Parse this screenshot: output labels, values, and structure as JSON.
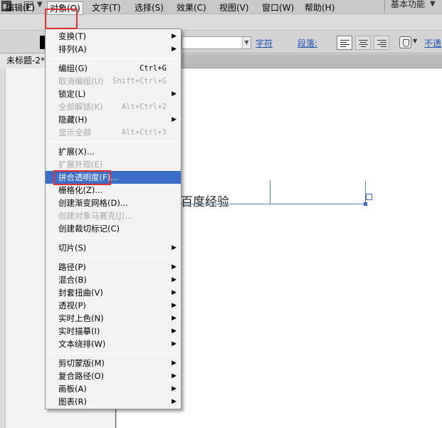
{
  "app_bar": {
    "logo": "Br",
    "workspace": "基本功能"
  },
  "menubar": {
    "edit": "编辑(E)",
    "object": "对象(O)",
    "text": "文字(T)",
    "select": "选择(S)",
    "effect": "效果(C)",
    "view": "视图(V)",
    "window": "窗口(W)",
    "help": "帮助(H)"
  },
  "control_bar": {
    "char_link": "字符",
    "para_link": "段落:",
    "opacity_link": "不透"
  },
  "doc_tab": {
    "title": "未标题-2*"
  },
  "canvas": {
    "text": "百度经验"
  },
  "object_menu": {
    "items": [
      {
        "label": "变换(T)",
        "submenu": true
      },
      {
        "label": "排列(A)",
        "submenu": true
      },
      {
        "label": "编组(G)",
        "shortcut": "Ctrl+G"
      },
      {
        "label": "取消编组(U)",
        "shortcut": "Shift+Ctrl+G",
        "disabled": true
      },
      {
        "label": "锁定(L)",
        "submenu": true
      },
      {
        "label": "全部解锁(K)",
        "shortcut": "Alt+Ctrl+2",
        "disabled": true
      },
      {
        "label": "隐藏(H)",
        "submenu": true
      },
      {
        "label": "显示全部",
        "shortcut": "Alt+Ctrl+3",
        "disabled": true
      },
      {
        "label": "扩展(X)..."
      },
      {
        "label": "扩展外观(E)",
        "disabled": true
      },
      {
        "label": "拼合透明度(F)...",
        "selected": true
      },
      {
        "label": "栅格化(Z)..."
      },
      {
        "label": "创建渐变网格(D)..."
      },
      {
        "label": "创建对象马赛克(J)...",
        "disabled": true
      },
      {
        "label": "创建裁切标记(C)"
      },
      {
        "label": "切片(S)",
        "submenu": true
      },
      {
        "label": "路径(P)",
        "submenu": true
      },
      {
        "label": "混合(B)",
        "submenu": true
      },
      {
        "label": "封套扭曲(V)",
        "submenu": true
      },
      {
        "label": "透视(P)",
        "submenu": true
      },
      {
        "label": "实时上色(N)",
        "submenu": true
      },
      {
        "label": "实时描摹(I)",
        "submenu": true
      },
      {
        "label": "文本绕排(W)",
        "submenu": true
      },
      {
        "label": "剪切蒙版(M)",
        "submenu": true
      },
      {
        "label": "复合路径(O)",
        "submenu": true
      },
      {
        "label": "画板(A)",
        "submenu": true
      },
      {
        "label": "图表(R)",
        "submenu": true
      }
    ]
  },
  "colors": {
    "menu_highlight": "#3a6ec8",
    "annotation_red": "#e03030",
    "link_blue": "#1b4fb3"
  }
}
